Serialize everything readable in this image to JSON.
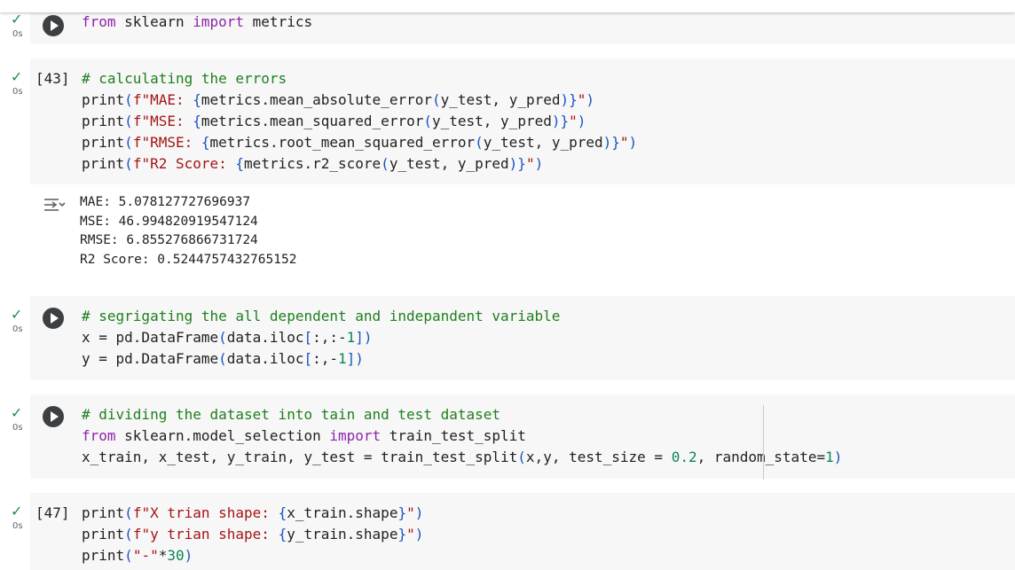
{
  "top_status": {
    "check": "✓",
    "time": "0s"
  },
  "cells": [
    {
      "id": "imports",
      "time": "0s",
      "check": "✓",
      "execution_count": "",
      "lines": [
        [
          {
            "t": "from",
            "c": "kw"
          },
          {
            "t": " sklearn "
          },
          {
            "t": "import",
            "c": "kw"
          },
          {
            "t": " metrics"
          }
        ]
      ]
    },
    {
      "id": "errors",
      "time": "0s",
      "check": "✓",
      "execution_count": "[43]",
      "lines": [
        [
          {
            "t": "# calculating the errors",
            "c": "com"
          }
        ],
        [
          {
            "t": "print"
          },
          {
            "t": "(",
            "c": "bo"
          },
          {
            "t": "f\"MAE: ",
            "c": "str"
          },
          {
            "t": "{",
            "c": "bo"
          },
          {
            "t": "metrics.mean_absolute_error"
          },
          {
            "t": "(",
            "c": "bo"
          },
          {
            "t": "y_test, y_pred"
          },
          {
            "t": ")}",
            "c": "bo"
          },
          {
            "t": "\"",
            "c": "str"
          },
          {
            "t": ")",
            "c": "bo"
          }
        ],
        [
          {
            "t": "print"
          },
          {
            "t": "(",
            "c": "bo"
          },
          {
            "t": "f\"MSE: ",
            "c": "str"
          },
          {
            "t": "{",
            "c": "bo"
          },
          {
            "t": "metrics.mean_squared_error"
          },
          {
            "t": "(",
            "c": "bo"
          },
          {
            "t": "y_test, y_pred"
          },
          {
            "t": ")}",
            "c": "bo"
          },
          {
            "t": "\"",
            "c": "str"
          },
          {
            "t": ")",
            "c": "bo"
          }
        ],
        [
          {
            "t": "print"
          },
          {
            "t": "(",
            "c": "bo"
          },
          {
            "t": "f\"RMSE: ",
            "c": "str"
          },
          {
            "t": "{",
            "c": "bo"
          },
          {
            "t": "metrics.root_mean_squared_error"
          },
          {
            "t": "(",
            "c": "bo"
          },
          {
            "t": "y_test, y_pred"
          },
          {
            "t": ")}",
            "c": "bo"
          },
          {
            "t": "\"",
            "c": "str"
          },
          {
            "t": ")",
            "c": "bo"
          }
        ],
        [
          {
            "t": "print"
          },
          {
            "t": "(",
            "c": "bo"
          },
          {
            "t": "f\"R2 Score: ",
            "c": "str"
          },
          {
            "t": "{",
            "c": "bo"
          },
          {
            "t": "metrics.r2_score"
          },
          {
            "t": "(",
            "c": "bo"
          },
          {
            "t": "y_test, y_pred"
          },
          {
            "t": ")}",
            "c": "bo"
          },
          {
            "t": "\"",
            "c": "str"
          },
          {
            "t": ")",
            "c": "bo"
          }
        ]
      ]
    },
    {
      "id": "segregate",
      "time": "0s",
      "check": "✓",
      "execution_count": "",
      "lines": [
        [
          {
            "t": "# segrigating the all dependent and indepandent variable",
            "c": "com"
          }
        ],
        [
          {
            "t": "x = pd.DataFrame"
          },
          {
            "t": "(",
            "c": "bo"
          },
          {
            "t": "data.iloc"
          },
          {
            "t": "[",
            "c": "bo"
          },
          {
            "t": ":,:-"
          },
          {
            "t": "1",
            "c": "num"
          },
          {
            "t": "])",
            "c": "bo"
          }
        ],
        [
          {
            "t": "y = pd.DataFrame"
          },
          {
            "t": "(",
            "c": "bo"
          },
          {
            "t": "data.iloc"
          },
          {
            "t": "[",
            "c": "bo"
          },
          {
            "t": ":,-"
          },
          {
            "t": "1",
            "c": "num"
          },
          {
            "t": "])",
            "c": "bo"
          }
        ]
      ]
    },
    {
      "id": "split",
      "time": "0s",
      "check": "✓",
      "execution_count": "",
      "lines": [
        [
          {
            "t": "# dividing the dataset into tain and test dataset",
            "c": "com"
          }
        ],
        [
          {
            "t": "from",
            "c": "kw"
          },
          {
            "t": " sklearn.model_selection "
          },
          {
            "t": "import",
            "c": "kw"
          },
          {
            "t": " train_test_split"
          }
        ],
        [
          {
            "t": "x_train, x_test, y_train, y_test = train_test_split"
          },
          {
            "t": "(",
            "c": "bo"
          },
          {
            "t": "x,y, test_size = "
          },
          {
            "t": "0.2",
            "c": "num"
          },
          {
            "t": ", random_state="
          },
          {
            "t": "1",
            "c": "num"
          },
          {
            "t": ")",
            "c": "bo"
          }
        ]
      ]
    },
    {
      "id": "shapes",
      "time": "0s",
      "check": "✓",
      "execution_count": "[47]",
      "lines": [
        [
          {
            "t": "print"
          },
          {
            "t": "(",
            "c": "bo"
          },
          {
            "t": "f\"X trian shape: ",
            "c": "str"
          },
          {
            "t": "{",
            "c": "bo"
          },
          {
            "t": "x_train.shape"
          },
          {
            "t": "}",
            "c": "bo"
          },
          {
            "t": "\"",
            "c": "str"
          },
          {
            "t": ")",
            "c": "bo"
          }
        ],
        [
          {
            "t": "print"
          },
          {
            "t": "(",
            "c": "bo"
          },
          {
            "t": "f\"y trian shape: ",
            "c": "str"
          },
          {
            "t": "{",
            "c": "bo"
          },
          {
            "t": "y_train.shape"
          },
          {
            "t": "}",
            "c": "bo"
          },
          {
            "t": "\"",
            "c": "str"
          },
          {
            "t": ")",
            "c": "bo"
          }
        ],
        [
          {
            "t": "print"
          },
          {
            "t": "(",
            "c": "bo"
          },
          {
            "t": "\"-\"",
            "c": "str"
          },
          {
            "t": "*"
          },
          {
            "t": "30",
            "c": "num"
          },
          {
            "t": ")",
            "c": "bo"
          }
        ]
      ]
    }
  ],
  "output_errors": [
    "MAE: 5.078127727696937",
    "MSE: 46.994820919547124",
    "RMSE: 6.855276866731724",
    "R2 Score: 0.5244757432765152"
  ],
  "output_icon": "output-toggle-icon"
}
